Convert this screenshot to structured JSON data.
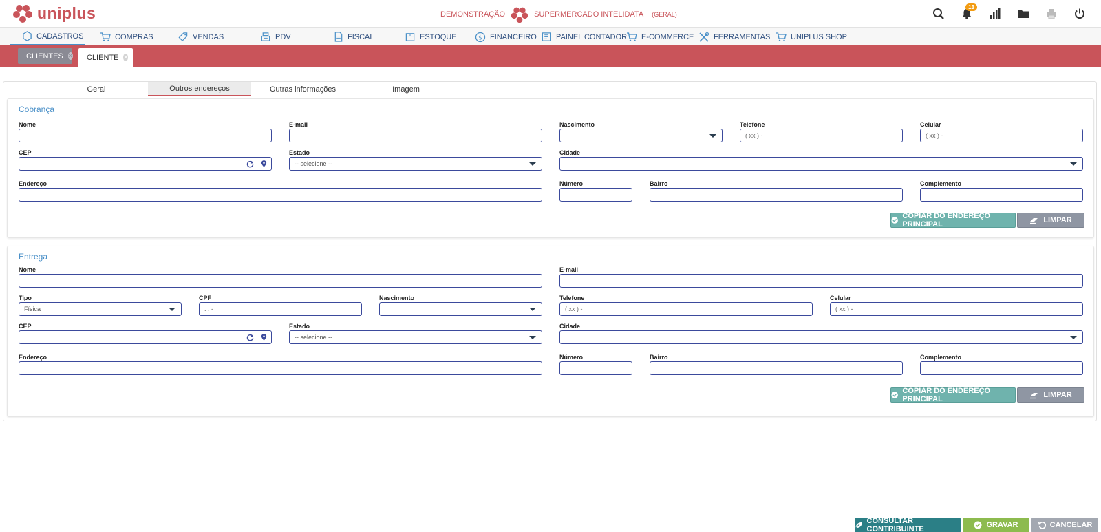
{
  "brand": {
    "name": "uniplus",
    "color": "#c9545a"
  },
  "company": {
    "mode": "DEMONSTRAÇÃO",
    "name": "SUPERMERCADO INTELIDATA",
    "scope": "(GERAL)"
  },
  "notifications": {
    "count": "13"
  },
  "top_icons": [
    "search-icon",
    "bell-icon",
    "chart-icon",
    "folder-icon",
    "printer-icon",
    "power-icon"
  ],
  "menu": [
    {
      "label": "CADASTROS",
      "icon": "hexagon-icon"
    },
    {
      "label": "COMPRAS",
      "icon": "cart-icon"
    },
    {
      "label": "VENDAS",
      "icon": "tag-icon"
    },
    {
      "label": "PDV",
      "icon": "register-icon"
    },
    {
      "label": "FISCAL",
      "icon": "document-icon"
    },
    {
      "label": "ESTOQUE",
      "icon": "box-icon"
    },
    {
      "label": "FINANCEIRO",
      "icon": "dollar-icon"
    },
    {
      "label": "PAINEL CONTADOR",
      "icon": "ledger-icon"
    },
    {
      "label": "E-COMMERCE",
      "icon": "cart-icon"
    },
    {
      "label": "FERRAMENTAS",
      "icon": "tools-icon"
    },
    {
      "label": "UNIPLUS SHOP",
      "icon": "cart-icon"
    }
  ],
  "doc_tabs": [
    {
      "label": "CLIENTES"
    },
    {
      "label": "CLIENTE"
    }
  ],
  "subtabs": [
    "Geral",
    "Outros endereços",
    "Outras informações",
    "Imagem"
  ],
  "cobranca": {
    "title": "Cobrança",
    "labels": {
      "nome": "Nome",
      "email": "E-mail",
      "nascimento": "Nascimento",
      "telefone": "Telefone",
      "celular": "Celular",
      "cep": "CEP",
      "estado": "Estado",
      "cidade": "Cidade",
      "endereco": "Endereço",
      "numero": "Número",
      "bairro": "Bairro",
      "complemento": "Complemento"
    },
    "phone_mask": "( xx )     -",
    "estado_value": "-- selecione --",
    "copy_button": "COPIAR DO ENDEREÇO PRINCIPAL",
    "clear_button": "LIMPAR"
  },
  "entrega": {
    "title": "Entrega",
    "labels": {
      "nome": "Nome",
      "email": "E-mail",
      "tipo": "Tipo",
      "cpf": "CPF",
      "nascimento": "Nascimento",
      "telefone": "Telefone",
      "celular": "Celular",
      "cep": "CEP",
      "estado": "Estado",
      "cidade": "Cidade",
      "endereco": "Endereço",
      "numero": "Número",
      "bairro": "Bairro",
      "complemento": "Complemento"
    },
    "tipo_value": "Física",
    "cpf_mask": "   .    .    -",
    "phone_mask": "( xx )     -",
    "estado_value": "-- selecione --",
    "copy_button": "COPIAR DO ENDEREÇO PRINCIPAL",
    "clear_button": "LIMPAR"
  },
  "footer": {
    "consultar": "CONSULTAR CONTRIBUINTE",
    "gravar": "GRAVAR",
    "cancelar": "CANCELAR"
  }
}
